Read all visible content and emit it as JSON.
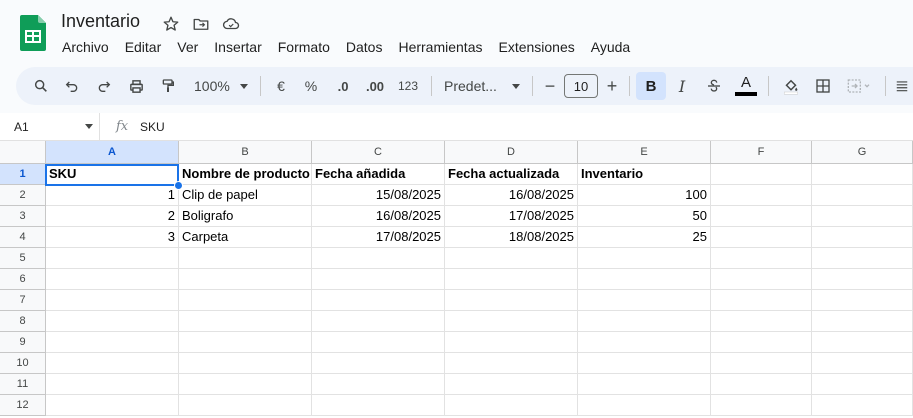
{
  "app": {
    "title": "Inventario",
    "menu": [
      "Archivo",
      "Editar",
      "Ver",
      "Insertar",
      "Formato",
      "Datos",
      "Herramientas",
      "Extensiones",
      "Ayuda"
    ]
  },
  "toolbar": {
    "zoom": "100%",
    "currency": "€",
    "percent": "%",
    "dec_decrease": ".0",
    "dec_increase": ".00",
    "number_format": "123",
    "font": "Predet...",
    "font_size": "10",
    "minus": "−",
    "plus": "+",
    "bold": "B",
    "italic": "I",
    "text_color": "A"
  },
  "formula_bar": {
    "cell_ref": "A1",
    "fx": "fx",
    "value": "SKU"
  },
  "sheet": {
    "columns": [
      "A",
      "B",
      "C",
      "D",
      "E",
      "F",
      "G"
    ],
    "rows": [
      "1",
      "2",
      "3",
      "4",
      "5",
      "6",
      "7",
      "8",
      "9",
      "10",
      "11",
      "12"
    ],
    "headers": [
      "SKU",
      "Nombre de producto",
      "Fecha añadida",
      "Fecha actualizada",
      "Inventario"
    ],
    "data": [
      [
        "1",
        "Clip de papel",
        "15/08/2025",
        "16/08/2025",
        "100"
      ],
      [
        "2",
        "Boligrafo",
        "16/08/2025",
        "17/08/2025",
        "50"
      ],
      [
        "3",
        "Carpeta",
        "17/08/2025",
        "18/08/2025",
        "25"
      ]
    ]
  },
  "colors": {
    "accent": "#1a73e8",
    "selection_header": "#d3e3fd",
    "logo_green": "#0f9d58"
  }
}
